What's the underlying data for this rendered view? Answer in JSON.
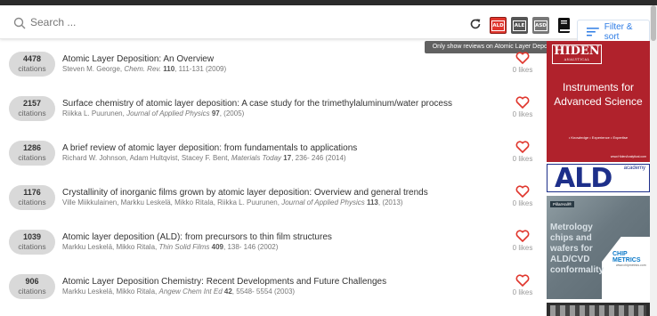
{
  "search": {
    "placeholder": "Search ..."
  },
  "toolbar": {
    "tags": [
      "ALD",
      "ALE",
      "ASD"
    ],
    "filter_label": "Filter & sort",
    "tooltip": "Only show reviews on Atomic Layer Deposition"
  },
  "papers": [
    {
      "citations": "4478",
      "citations_label": "citations",
      "title": "Atomic Layer Deposition: An Overview",
      "authors": "Steven M. George,",
      "journal": "Chem. Rev.",
      "volume": "110",
      "pages_year": ", 111-131 (2009)",
      "likes": "0 likes"
    },
    {
      "citations": "2157",
      "citations_label": "citations",
      "title": "Surface chemistry of atomic layer deposition: A case study for the trimethylaluminum/water process",
      "authors": "Riikka L. Puurunen,",
      "journal": "Journal of Applied Physics",
      "volume": "97",
      "pages_year": ",  (2005)",
      "likes": "0 likes"
    },
    {
      "citations": "1286",
      "citations_label": "citations",
      "title": "A brief review of atomic layer deposition: from fundamentals to applications",
      "authors": "Richard W. Johnson, Adam Hultqvist, Stacey F. Bent,",
      "journal": "Materials Today",
      "volume": "17",
      "pages_year": ", 236- 246 (2014)",
      "likes": "0 likes"
    },
    {
      "citations": "1176",
      "citations_label": "citations",
      "title": "Crystallinity of inorganic films grown by atomic layer deposition: Overview and general trends",
      "authors": "Ville Miikkulainen, Markku Leskelä, Mikko Ritala, Riikka L. Puurunen,",
      "journal": "Journal of Applied Physics",
      "volume": "113",
      "pages_year": ",  (2013)",
      "likes": "0 likes"
    },
    {
      "citations": "1039",
      "citations_label": "citations",
      "title": "Atomic layer deposition (ALD): from precursors to thin film structures",
      "authors": "Markku Leskelä, Mikko Ritala,",
      "journal": "Thin Solid Films",
      "volume": "409",
      "pages_year": ", 138- 146 (2002)",
      "likes": "0 likes"
    },
    {
      "citations": "906",
      "citations_label": "citations",
      "title": "Atomic Layer Deposition Chemistry: Recent Developments and Future Challenges",
      "authors": "Markku Leskelä, Mikko Ritala,",
      "journal": "Angew Chem Int Ed",
      "volume": "42",
      "pages_year": ", 5548- 5554 (2003)",
      "likes": "0 likes"
    }
  ],
  "ads": {
    "hiden": {
      "logo": "HIDEN",
      "sub": "ANALYTICAL",
      "headline": "Instruments for Advanced Science",
      "tags": "• Knowledge • Experience • Expertise",
      "url": "www.HidenAnalytical.com"
    },
    "ald": {
      "logo": "ALD",
      "sub": "academy"
    },
    "chip": {
      "badge": "PillarHall®",
      "text": "Metrology chips and wafers for ALD/CVD conformality",
      "logo_line1": "CHIP",
      "logo_line2": "METRICS",
      "url": "www.chipmetrics.com"
    }
  },
  "colors": {
    "accent": "#2c7be5",
    "heart": "#e0362d",
    "ald_tag": "#e0362d",
    "hiden_red": "#b0222c",
    "ald_blue": "#1d2f8a"
  }
}
